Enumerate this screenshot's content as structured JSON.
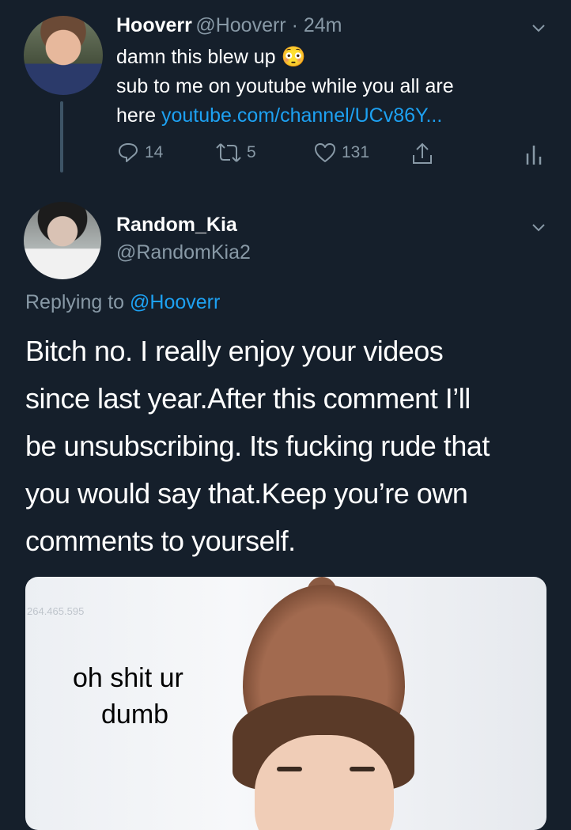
{
  "tweet1": {
    "name": "Hooverr",
    "handle": "@Hooverr · 24m",
    "line1": "damn this blew up",
    "emoji": "😳",
    "line2": "sub to me on youtube while you all are",
    "line3_prefix": "here",
    "link": "youtube.com/channel/UCv86Y...",
    "replies": "14",
    "retweets": "5",
    "likes": "131"
  },
  "tweet2": {
    "name": "Random_Kia",
    "handle": "@RandomKia2",
    "replying_label": "Replying to",
    "replying_to": "@Hooverr",
    "lines": [
      "Bitch no. I really enjoy your videos",
      "since last year.After this comment I’ll",
      "be unsubscribing. Its fucking rude that",
      "you would say that.Keep you’re own",
      "comments to yourself."
    ],
    "image": {
      "watermark": "264.465.595",
      "caption_line1": "oh shit ur",
      "caption_line2": "dumb"
    }
  },
  "icons": {
    "reply": "reply-icon",
    "retweet": "retweet-icon",
    "like": "heart-icon",
    "share": "share-icon",
    "analytics": "analytics-icon",
    "more": "chevron-down-icon"
  },
  "colors": {
    "background": "#151f2b",
    "link": "#1da1f2",
    "muted": "#8899a6"
  }
}
